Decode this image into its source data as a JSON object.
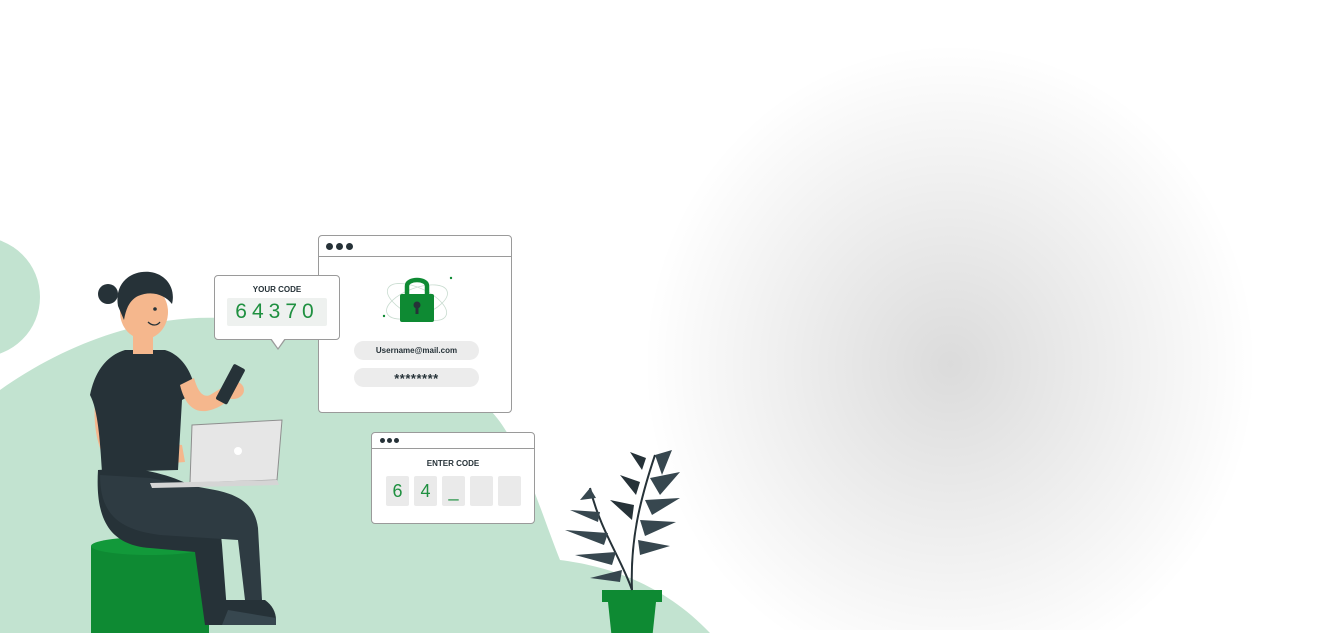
{
  "your_code": {
    "title": "YOUR CODE",
    "value": "64370"
  },
  "login_window": {
    "email": "Username@mail.com",
    "password": "********"
  },
  "enter_code": {
    "title": "ENTER CODE",
    "digits": [
      "6",
      "4",
      "_",
      "",
      ""
    ]
  },
  "colors": {
    "accent_green": "#0e8a33",
    "light_green": "#c2e3d0",
    "dark": "#263238",
    "skin": "#f5b78d"
  }
}
